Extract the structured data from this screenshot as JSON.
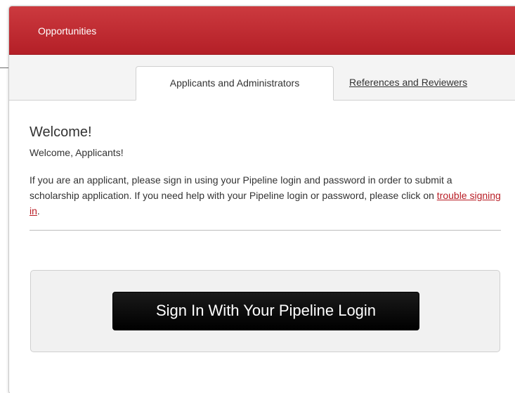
{
  "header": {
    "title": "Opportunities"
  },
  "tabs": [
    {
      "label": "Applicants and Administrators",
      "active": true
    },
    {
      "label": "References and Reviewers",
      "active": false
    }
  ],
  "main": {
    "heading": "Welcome!",
    "subheading": "Welcome, Applicants!",
    "intro_before_link": "If you are an applicant, please sign in using your Pipeline login and password in order to submit a scholarship application. If you need help with your Pipeline login or password, please click on ",
    "intro_link": "trouble signing in",
    "intro_after_link": "."
  },
  "login": {
    "button_label": "Sign In With Your Pipeline Login"
  },
  "colors": {
    "header_red": "#b41f27",
    "link_red": "#b81c24",
    "button_black": "#000000"
  }
}
